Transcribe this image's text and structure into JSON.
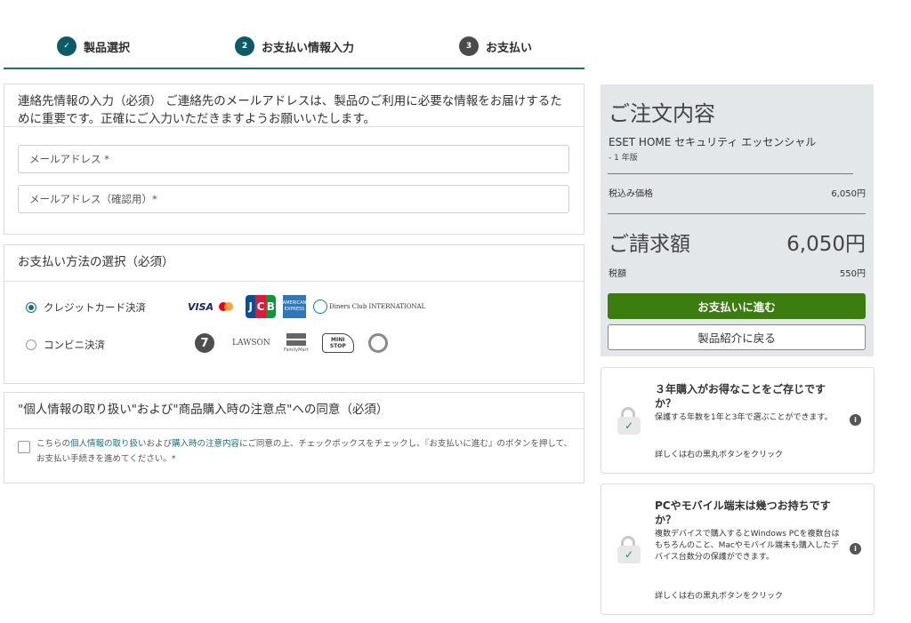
{
  "stepper": {
    "steps": [
      {
        "num": "✓",
        "label": "製品選択"
      },
      {
        "num": "2",
        "label": "お支払い情報入力"
      },
      {
        "num": "3",
        "label": "お支払い"
      }
    ]
  },
  "contact": {
    "heading": "連絡先情報の入力（必須） ご連絡先のメールアドレスは、製品のご利用に必要な情報をお届けするために重要です。正確にご入力いただきますようお願いいたします。",
    "email_placeholder": "メールアドレス *",
    "email_confirm_placeholder": "メールアドレス（確認用）*"
  },
  "payment": {
    "heading": "お支払い方法の選択（必須）",
    "options": [
      {
        "label": "クレジットカード決済",
        "selected": true
      },
      {
        "label": "コンビニ決済",
        "selected": false
      }
    ],
    "card_logos": {
      "visa": "VISA",
      "jcb": [
        "J",
        "C",
        "B"
      ],
      "amex": "AMERICAN EXPRESS",
      "diners": "Diners Club INTERNATIONAL"
    },
    "cvs_logos": {
      "seven": "7",
      "lawson": "LAWSON",
      "familymart": "FamilyMart",
      "ministop": "MINI STOP"
    }
  },
  "consent": {
    "heading": "\"個人情報の取り扱い\"および\"商品購入時の注意点\"への同意（必須）",
    "text_before": "こちらの",
    "link1": "個人情報の取り扱い",
    "text_mid": "および",
    "link2": "購入時の注意内容",
    "text_after": "にご同意の上、チェックボックスをチェックし、『お支払いに進む』のボタンを押して、お支払い手続きを進めてください。*"
  },
  "summary": {
    "title": "ご注文内容",
    "product": "ESET HOME セキュリティ エッセンシャル",
    "version": "- 1 年版",
    "price_label": "税込み価格",
    "price_value": "6,050円",
    "bill_label": "ご請求額",
    "bill_value": "6,050円",
    "tax_label": "税額",
    "tax_value": "550円",
    "proceed_button": "お支払いに進む",
    "back_button": "製品紹介に戻る"
  },
  "cards": [
    {
      "title": "３年購入がお得なことをご存じですか？",
      "body": "保護する年数を1年と3年で選ぶことができます。",
      "link": "詳しくは右の黒丸ボタンをクリック"
    },
    {
      "title": "PCやモバイル端末は幾つお持ちですか？",
      "body": "複数デバイスで購入するとWindows PCを複数台はもちろんのこと、Macやモバイル端末も購入したデバイス台数分の保護ができます。",
      "link": "詳しくは右の黒丸ボタンをクリック"
    }
  ],
  "colors": {
    "accent": "#0e5b68",
    "primary_button": "#3b7d0f",
    "summary_bg": "#e4e7ea"
  }
}
